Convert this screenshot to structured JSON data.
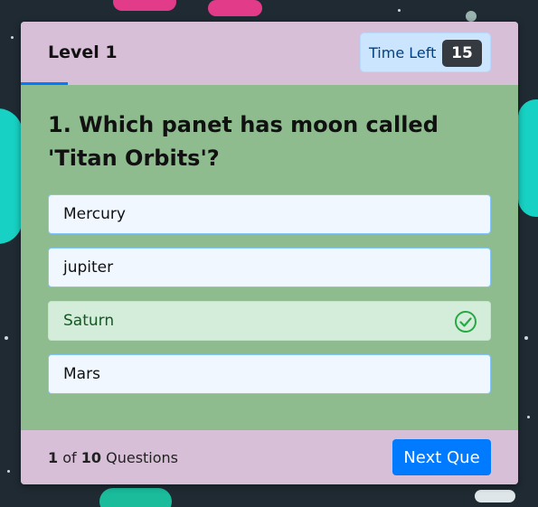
{
  "header": {
    "level": "Level 1",
    "time_label": "Time Left",
    "time_value": "15"
  },
  "question": {
    "text": "1. Which panet has moon called 'Titan Orbits'?"
  },
  "options": [
    {
      "label": "Mercury",
      "state": "default"
    },
    {
      "label": "jupiter",
      "state": "default"
    },
    {
      "label": "Saturn",
      "state": "correct",
      "icon": "check-circle-icon"
    },
    {
      "label": "Mars",
      "state": "default"
    }
  ],
  "footer": {
    "current": "1",
    "of": "of",
    "total": "10",
    "suffix": "Questions",
    "next_label": "Next Que"
  },
  "colors": {
    "accent": "#007bff",
    "panel": "#d8bfd8",
    "body": "#8fbc8f",
    "correct": "#28a745"
  }
}
